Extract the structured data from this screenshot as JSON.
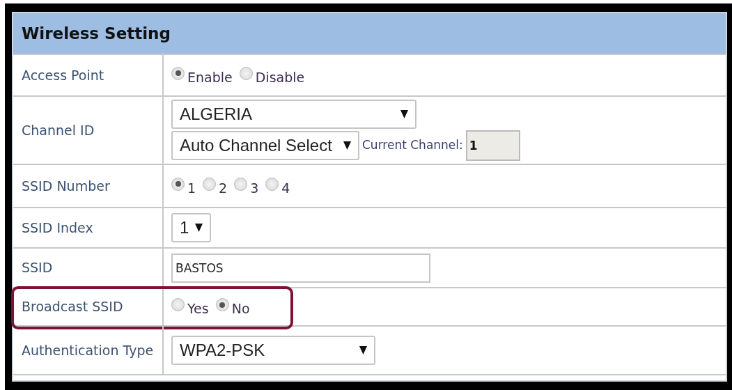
{
  "panel": {
    "title": "Wireless Setting"
  },
  "rows": [
    {
      "label": "Access Point",
      "kind": "radio",
      "options": [
        {
          "label": "Enable",
          "selected": true
        },
        {
          "label": "Disable",
          "selected": false
        }
      ]
    },
    {
      "label": "Channel ID",
      "kind": "channel",
      "country": {
        "value": "ALGERIA"
      },
      "channel_select": {
        "value": "Auto Channel Select"
      },
      "current_channel": {
        "label": "Current Channel:",
        "value": "1",
        "disabled": true
      }
    },
    {
      "label": "SSID Number",
      "kind": "radio",
      "options": [
        {
          "label": "1",
          "selected": true
        },
        {
          "label": "2",
          "selected": false
        },
        {
          "label": "3",
          "selected": false
        },
        {
          "label": "4",
          "selected": false
        }
      ]
    },
    {
      "label": "SSID Index",
      "kind": "select",
      "value": "1"
    },
    {
      "label": "SSID",
      "kind": "text",
      "value": "BASTOS"
    },
    {
      "label": "Broadcast SSID",
      "kind": "radio",
      "highlighted": true,
      "options": [
        {
          "label": "Yes",
          "selected": false
        },
        {
          "label": "No",
          "selected": true
        }
      ]
    },
    {
      "label": "Authentication Type",
      "kind": "select",
      "value": "WPA2-PSK"
    }
  ]
}
